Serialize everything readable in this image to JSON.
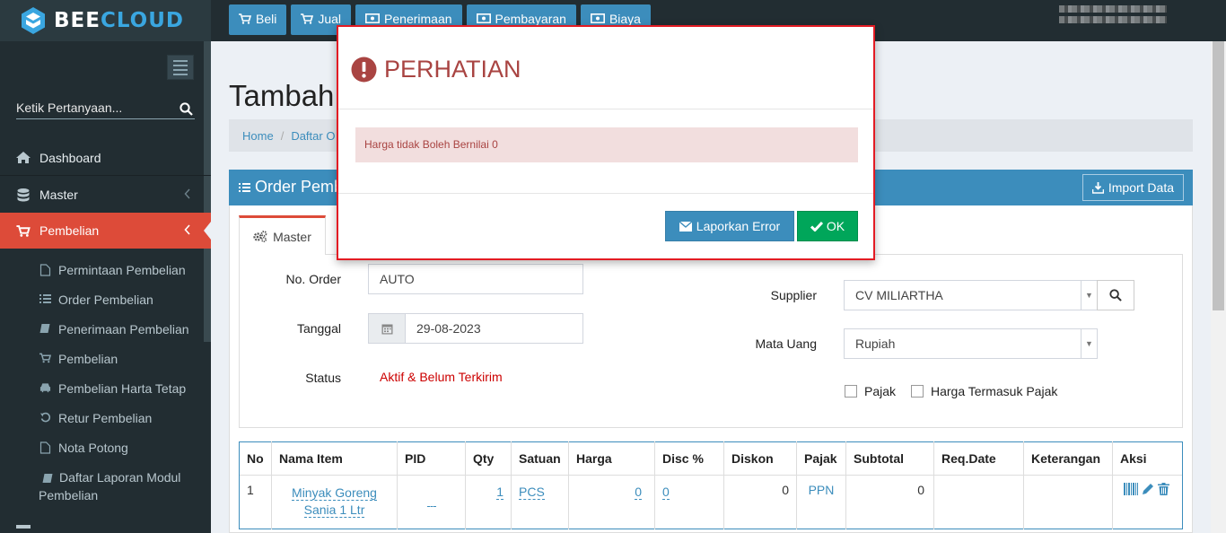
{
  "brand": {
    "part1": "BEE",
    "part2": "CLOUD"
  },
  "topnav": [
    {
      "label": "Beli",
      "icon": "cart-icon"
    },
    {
      "label": "Jual",
      "icon": "cart-icon"
    },
    {
      "label": "Penerimaan",
      "icon": "money-icon"
    },
    {
      "label": "Pembayaran",
      "icon": "money-icon"
    },
    {
      "label": "Biaya",
      "icon": "money-icon"
    }
  ],
  "sidebar": {
    "search_placeholder": "Ketik Pertanyaan...",
    "menu": [
      {
        "label": "Dashboard",
        "icon": "home-icon"
      },
      {
        "label": "Master",
        "icon": "database-icon"
      },
      {
        "label": "Pembelian",
        "icon": "cart-icon"
      }
    ],
    "submenu": [
      {
        "label": "Permintaan Pembelian",
        "icon": "file-icon"
      },
      {
        "label": "Order Pembelian",
        "icon": "list-icon"
      },
      {
        "label": "Penerimaan Pembelian",
        "icon": "book-icon"
      },
      {
        "label": "Pembelian",
        "icon": "cart-icon"
      },
      {
        "label": "Pembelian Harta Tetap",
        "icon": "car-icon"
      },
      {
        "label": "Retur Pembelian",
        "icon": "undo-icon"
      },
      {
        "label": "Nota Potong",
        "icon": "file-icon"
      },
      {
        "label": "Daftar Laporan Modul Pembelian",
        "icon": "book-icon"
      }
    ]
  },
  "page": {
    "title": "Tambah",
    "breadcrumb": [
      "Home",
      "Daftar O"
    ],
    "panel_title": "Order Pemb",
    "import_label": "Import Data",
    "tab_label": "Master"
  },
  "form": {
    "no_order_label": "No. Order",
    "no_order_value": "AUTO",
    "tanggal_label": "Tanggal",
    "tanggal_value": "29-08-2023",
    "status_label": "Status",
    "status_value": "Aktif & Belum Terkirim",
    "supplier_label": "Supplier",
    "supplier_value": "CV MILIARTHA",
    "mata_uang_label": "Mata Uang",
    "mata_uang_value": "Rupiah",
    "pajak_label": "Pajak",
    "harga_termasuk_pajak_label": "Harga Termasuk Pajak"
  },
  "table": {
    "headers": [
      "No",
      "Nama Item",
      "PID",
      "Qty",
      "Satuan",
      "Harga",
      "Disc %",
      "Diskon",
      "Pajak",
      "Subtotal",
      "Req.Date",
      "Keterangan",
      "Aksi"
    ],
    "rows": [
      {
        "no": "1",
        "nama_item": "Minyak Goreng Sania 1 Ltr",
        "pid": "",
        "qty": "1",
        "satuan": "PCS",
        "harga": "0",
        "disc": "0",
        "diskon": "0",
        "pajak": "PPN",
        "subtotal": "0",
        "req_date": "",
        "keterangan": ""
      }
    ]
  },
  "modal": {
    "title": "PERHATIAN",
    "message": "Harga tidak Boleh Bernilai 0",
    "report_label": "Laporkan Error",
    "ok_label": "OK"
  },
  "colors": {
    "accent": "#3c8dbc",
    "danger": "#dd4b39",
    "success": "#00a65a",
    "modal_border": "#e31b23"
  }
}
